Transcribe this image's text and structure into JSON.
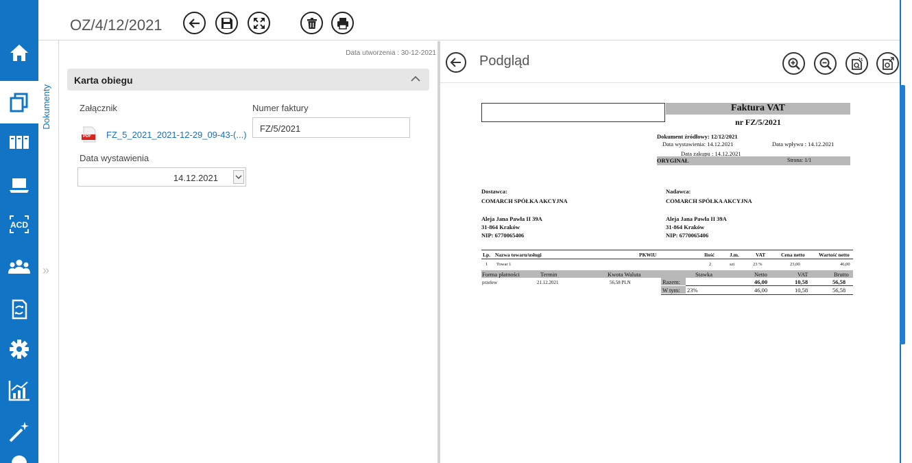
{
  "nav": {
    "items": [
      {
        "name": "home",
        "icon": "home-icon"
      },
      {
        "name": "documents",
        "icon": "documents-icon",
        "active": true
      },
      {
        "name": "binders",
        "icon": "binders-icon"
      },
      {
        "name": "laptop",
        "icon": "laptop-icon"
      },
      {
        "name": "ocr",
        "icon": "acd-icon",
        "icon_text": "ACD"
      },
      {
        "name": "users",
        "icon": "users-icon"
      },
      {
        "name": "workflow",
        "icon": "workflow-icon"
      },
      {
        "name": "settings",
        "icon": "gear-icon"
      },
      {
        "name": "reports",
        "icon": "chart-icon"
      },
      {
        "name": "wizard",
        "icon": "magic-wand-icon"
      }
    ],
    "accent": "#1274c4"
  },
  "side_tab": {
    "label": "Dokumenty",
    "expand": "»"
  },
  "header": {
    "title": "OZ/4/12/2021",
    "buttons": [
      "back-icon",
      "save-icon",
      "fullscreen-icon",
      "delete-icon",
      "print-icon"
    ]
  },
  "form": {
    "created": "Data utworzenia : 30-12-2021",
    "section_title": "Karta obiegu",
    "attachment_label": "Załącznik",
    "attachment_name": "FZ_5_2021_2021-12-29_09-43-(...)",
    "attachment_badge": "PDF",
    "invoice_number_label": "Numer faktury",
    "invoice_number_value": "FZ/5/2021",
    "issue_date_label": "Data wystawienia",
    "issue_date_value": "14.12.2021"
  },
  "preview": {
    "title": "Podgląd",
    "buttons": [
      "zoom-in-icon",
      "zoom-out-icon",
      "fit-page-icon",
      "open-external-icon"
    ]
  },
  "invoice": {
    "title": "Faktura VAT",
    "number": "nr FZ/5/2021",
    "source_doc": "Dokument źródłowy:  12/12/2021",
    "issue_date": "Data wystawienia: 14.12.2021",
    "receipt_date": "Data  wpływu : 14.12.2021",
    "purchase_date": "Data  zakupu : 14.12.2021",
    "original": "ORYGINAŁ",
    "page": "Strona: 1/1",
    "supplier_label": "Dostawca:",
    "supplier_name": "COMARCH SPÓŁKA AKCYJNA",
    "supplier_addr1": "Aleja Jana Pawła II 39A",
    "supplier_addr2": "31-864 Kraków",
    "supplier_nip": "NIP: 6770065406",
    "sender_label": "Nadawca:",
    "sender_name": "COMARCH SPÓŁKA AKCYJNA",
    "sender_addr1": "Aleja Jana Pawła II 39A",
    "sender_addr2": "31-864 Kraków",
    "sender_nip": "NIP: 6770065406",
    "items_header": {
      "lp": "Lp.",
      "name": "Nazwa towaru/usługi",
      "pkwiu": "PKWiU",
      "qty": "Ilość",
      "unit": "J.m.",
      "vat": "VAT",
      "price": "Cena netto",
      "value": "Wartość netto"
    },
    "items": [
      {
        "lp": "1",
        "name": "Towar 1",
        "qty": "2",
        "unit": "szt",
        "vat": "23 %",
        "price": "23,00",
        "value": "46,00"
      }
    ],
    "pay_header": {
      "form": "Forma płatności",
      "term": "Termin",
      "amount": "Kwota Waluta",
      "rate": "Stawka",
      "net": "Netto",
      "vat": "VAT",
      "gross": "Brutto"
    },
    "pay": {
      "form": "przelew",
      "term": "21.12.2021",
      "amount": "56,58  PLN"
    },
    "total": {
      "label": "Razem:",
      "net": "46,00",
      "vat": "10,58",
      "gross": "56,58"
    },
    "breakdown": {
      "label": "W tym:",
      "rate": "23%",
      "net": "46,00",
      "vat": "10,58",
      "gross": "56,58"
    }
  }
}
